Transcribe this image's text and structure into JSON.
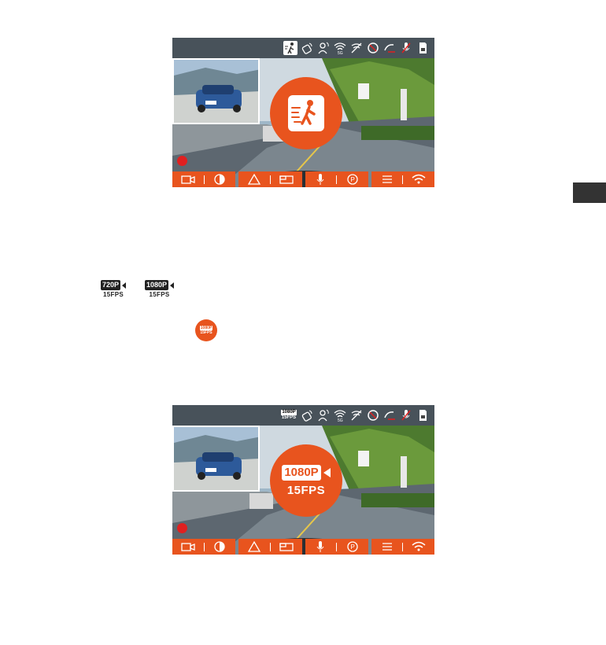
{
  "colors": {
    "accent": "#e8541e",
    "record": "#e02020",
    "sidetab": "#333333"
  },
  "screen1": {
    "status_icons": [
      "pedestrian-alert-icon",
      "vehicle-sensor-icon",
      "driver-icon",
      "wifi-5g-icon",
      "gps-off-icon",
      "lane-icon",
      "parking-icon",
      "mic-off-icon",
      "sd-card-icon"
    ],
    "center_icon": "pedestrian-alert-icon",
    "bottom_icons": [
      "video-icon",
      "contrast-icon",
      "triangle-icon",
      "screen-icon",
      "mic-icon",
      "parking-icon",
      "menu-icon",
      "wifi-icon"
    ]
  },
  "screen2": {
    "status_res": "1080P",
    "status_fps": "15FPS",
    "status_icons": [
      "vehicle-sensor-icon",
      "driver-icon",
      "wifi-5g-icon",
      "gps-off-icon",
      "lane-icon",
      "parking-icon",
      "mic-off-icon",
      "sd-card-icon"
    ],
    "center_res": "1080P",
    "center_fps": "15FPS",
    "bottom_icons": [
      "video-icon",
      "contrast-icon",
      "triangle-icon",
      "screen-icon",
      "mic-icon",
      "parking-icon",
      "menu-icon",
      "wifi-icon"
    ]
  },
  "options": [
    {
      "res": "720P",
      "fps": "15FPS"
    },
    {
      "res": "1080P",
      "fps": "15FPS"
    }
  ],
  "selected_badge": {
    "res": "1080P",
    "fps": "15FPS"
  },
  "wifi_band": "5G"
}
